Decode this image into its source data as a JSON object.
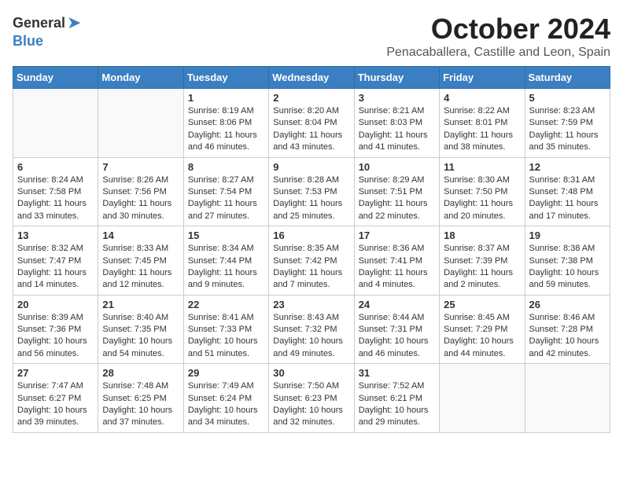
{
  "header": {
    "logo_general": "General",
    "logo_blue": "Blue",
    "month": "October 2024",
    "location": "Penacaballera, Castille and Leon, Spain"
  },
  "weekdays": [
    "Sunday",
    "Monday",
    "Tuesday",
    "Wednesday",
    "Thursday",
    "Friday",
    "Saturday"
  ],
  "weeks": [
    [
      {
        "day": "",
        "content": ""
      },
      {
        "day": "",
        "content": ""
      },
      {
        "day": "1",
        "content": "Sunrise: 8:19 AM\nSunset: 8:06 PM\nDaylight: 11 hours and 46 minutes."
      },
      {
        "day": "2",
        "content": "Sunrise: 8:20 AM\nSunset: 8:04 PM\nDaylight: 11 hours and 43 minutes."
      },
      {
        "day": "3",
        "content": "Sunrise: 8:21 AM\nSunset: 8:03 PM\nDaylight: 11 hours and 41 minutes."
      },
      {
        "day": "4",
        "content": "Sunrise: 8:22 AM\nSunset: 8:01 PM\nDaylight: 11 hours and 38 minutes."
      },
      {
        "day": "5",
        "content": "Sunrise: 8:23 AM\nSunset: 7:59 PM\nDaylight: 11 hours and 35 minutes."
      }
    ],
    [
      {
        "day": "6",
        "content": "Sunrise: 8:24 AM\nSunset: 7:58 PM\nDaylight: 11 hours and 33 minutes."
      },
      {
        "day": "7",
        "content": "Sunrise: 8:26 AM\nSunset: 7:56 PM\nDaylight: 11 hours and 30 minutes."
      },
      {
        "day": "8",
        "content": "Sunrise: 8:27 AM\nSunset: 7:54 PM\nDaylight: 11 hours and 27 minutes."
      },
      {
        "day": "9",
        "content": "Sunrise: 8:28 AM\nSunset: 7:53 PM\nDaylight: 11 hours and 25 minutes."
      },
      {
        "day": "10",
        "content": "Sunrise: 8:29 AM\nSunset: 7:51 PM\nDaylight: 11 hours and 22 minutes."
      },
      {
        "day": "11",
        "content": "Sunrise: 8:30 AM\nSunset: 7:50 PM\nDaylight: 11 hours and 20 minutes."
      },
      {
        "day": "12",
        "content": "Sunrise: 8:31 AM\nSunset: 7:48 PM\nDaylight: 11 hours and 17 minutes."
      }
    ],
    [
      {
        "day": "13",
        "content": "Sunrise: 8:32 AM\nSunset: 7:47 PM\nDaylight: 11 hours and 14 minutes."
      },
      {
        "day": "14",
        "content": "Sunrise: 8:33 AM\nSunset: 7:45 PM\nDaylight: 11 hours and 12 minutes."
      },
      {
        "day": "15",
        "content": "Sunrise: 8:34 AM\nSunset: 7:44 PM\nDaylight: 11 hours and 9 minutes."
      },
      {
        "day": "16",
        "content": "Sunrise: 8:35 AM\nSunset: 7:42 PM\nDaylight: 11 hours and 7 minutes."
      },
      {
        "day": "17",
        "content": "Sunrise: 8:36 AM\nSunset: 7:41 PM\nDaylight: 11 hours and 4 minutes."
      },
      {
        "day": "18",
        "content": "Sunrise: 8:37 AM\nSunset: 7:39 PM\nDaylight: 11 hours and 2 minutes."
      },
      {
        "day": "19",
        "content": "Sunrise: 8:38 AM\nSunset: 7:38 PM\nDaylight: 10 hours and 59 minutes."
      }
    ],
    [
      {
        "day": "20",
        "content": "Sunrise: 8:39 AM\nSunset: 7:36 PM\nDaylight: 10 hours and 56 minutes."
      },
      {
        "day": "21",
        "content": "Sunrise: 8:40 AM\nSunset: 7:35 PM\nDaylight: 10 hours and 54 minutes."
      },
      {
        "day": "22",
        "content": "Sunrise: 8:41 AM\nSunset: 7:33 PM\nDaylight: 10 hours and 51 minutes."
      },
      {
        "day": "23",
        "content": "Sunrise: 8:43 AM\nSunset: 7:32 PM\nDaylight: 10 hours and 49 minutes."
      },
      {
        "day": "24",
        "content": "Sunrise: 8:44 AM\nSunset: 7:31 PM\nDaylight: 10 hours and 46 minutes."
      },
      {
        "day": "25",
        "content": "Sunrise: 8:45 AM\nSunset: 7:29 PM\nDaylight: 10 hours and 44 minutes."
      },
      {
        "day": "26",
        "content": "Sunrise: 8:46 AM\nSunset: 7:28 PM\nDaylight: 10 hours and 42 minutes."
      }
    ],
    [
      {
        "day": "27",
        "content": "Sunrise: 7:47 AM\nSunset: 6:27 PM\nDaylight: 10 hours and 39 minutes."
      },
      {
        "day": "28",
        "content": "Sunrise: 7:48 AM\nSunset: 6:25 PM\nDaylight: 10 hours and 37 minutes."
      },
      {
        "day": "29",
        "content": "Sunrise: 7:49 AM\nSunset: 6:24 PM\nDaylight: 10 hours and 34 minutes."
      },
      {
        "day": "30",
        "content": "Sunrise: 7:50 AM\nSunset: 6:23 PM\nDaylight: 10 hours and 32 minutes."
      },
      {
        "day": "31",
        "content": "Sunrise: 7:52 AM\nSunset: 6:21 PM\nDaylight: 10 hours and 29 minutes."
      },
      {
        "day": "",
        "content": ""
      },
      {
        "day": "",
        "content": ""
      }
    ]
  ]
}
